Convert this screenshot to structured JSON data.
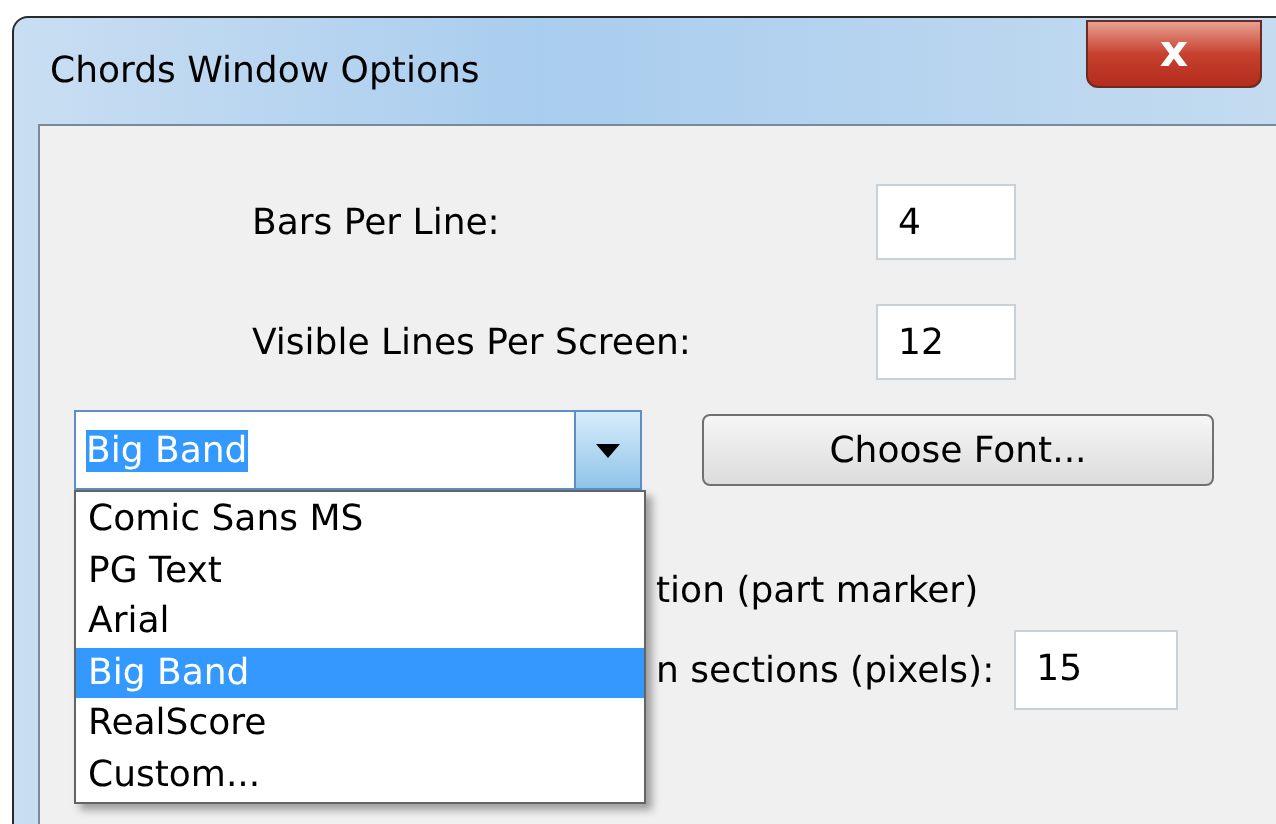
{
  "window": {
    "title": "Chords Window Options",
    "close": "x"
  },
  "fields": [
    {
      "label": "Bars Per Line:",
      "value": "4"
    },
    {
      "label": "Visible Lines Per Screen:",
      "value": "12"
    }
  ],
  "font_combo": {
    "value": "Big Band",
    "expanded": true,
    "options": [
      {
        "label": "Comic Sans MS",
        "selected": false
      },
      {
        "label": "PG Text",
        "selected": false
      },
      {
        "label": "Arial",
        "selected": false
      },
      {
        "label": "Big Band",
        "selected": true
      },
      {
        "label": "RealScore",
        "selected": false
      },
      {
        "label": "Custom...",
        "selected": false
      }
    ]
  },
  "choose_font_button": "Choose Font...",
  "partial_rows": [
    {
      "label": "tion (part marker)"
    },
    {
      "label": "n sections (pixels):",
      "value": "15"
    }
  ]
}
